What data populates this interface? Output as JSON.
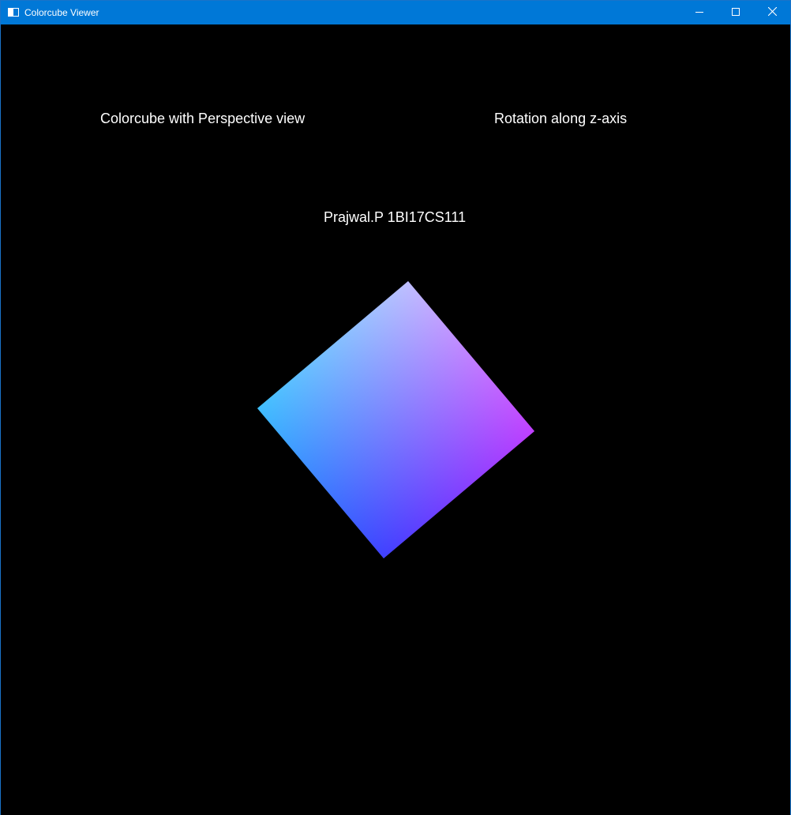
{
  "window": {
    "title": "Colorcube Viewer",
    "icon": "app-window-icon",
    "controls": {
      "minimize_icon": "minimize-icon",
      "maximize_icon": "maximize-icon",
      "close_icon": "close-icon"
    },
    "titlebar_color": "#0078d7"
  },
  "canvas": {
    "background": "#000000",
    "text_color": "#ffffff",
    "labels": {
      "perspective": "Colorcube with Perspective view",
      "rotation": "Rotation along z-axis",
      "author": "Prajwal.P 1BI17CS111"
    },
    "cube_face_corner_colors": {
      "top": "#ffffff",
      "left": "#00ffff",
      "right": "#ff00ff",
      "bottom": "#0000ff"
    }
  }
}
